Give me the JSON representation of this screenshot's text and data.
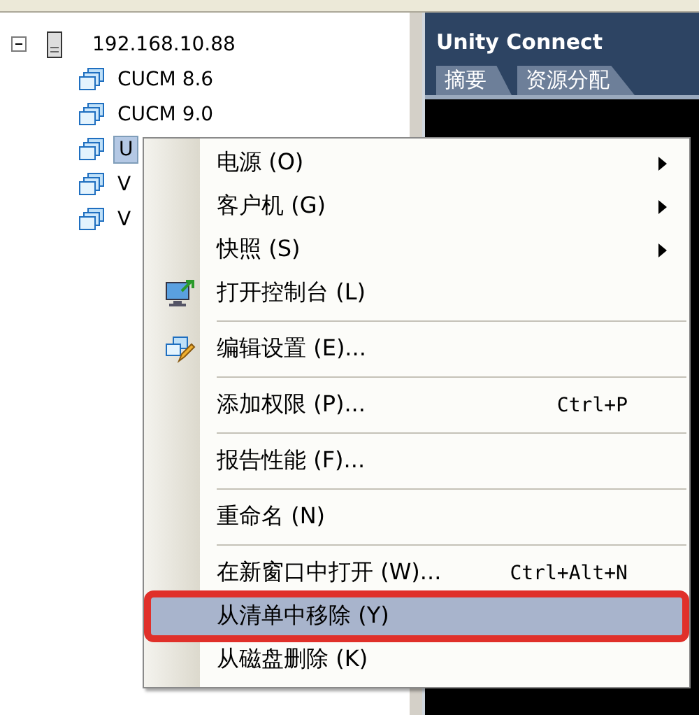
{
  "tree": {
    "root": {
      "label": "192.168.10.88",
      "expanded": true,
      "children": [
        {
          "label": "CUCM 8.6",
          "selected": false
        },
        {
          "label": "CUCM 9.0",
          "selected": false
        },
        {
          "label": "U",
          "selected": true
        },
        {
          "label": "V",
          "selected": false
        },
        {
          "label": "V",
          "selected": false
        }
      ]
    }
  },
  "detail": {
    "title": "Unity Connect",
    "tabs": [
      {
        "label": "摘要",
        "selected": false
      },
      {
        "label": "资源分配",
        "selected": false
      }
    ]
  },
  "context_menu": {
    "items": [
      {
        "kind": "submenu",
        "label": "电源 (O)",
        "selected": false
      },
      {
        "kind": "submenu",
        "label": "客户机 (G)",
        "selected": false
      },
      {
        "kind": "submenu",
        "label": "快照 (S)",
        "selected": false
      },
      {
        "kind": "console",
        "label": "打开控制台 (L)",
        "selected": false
      },
      {
        "kind": "separator"
      },
      {
        "kind": "edit",
        "label": "编辑设置 (E)...",
        "selected": false
      },
      {
        "kind": "separator"
      },
      {
        "kind": "item",
        "label": "添加权限 (P)...",
        "shortcut": "Ctrl+P",
        "selected": false
      },
      {
        "kind": "separator"
      },
      {
        "kind": "item",
        "label": "报告性能 (F)...",
        "selected": false
      },
      {
        "kind": "separator"
      },
      {
        "kind": "item",
        "label": "重命名 (N)",
        "selected": false
      },
      {
        "kind": "separator"
      },
      {
        "kind": "item",
        "label": "在新窗口中打开 (W)...",
        "shortcut": "Ctrl+Alt+N",
        "selected": false
      },
      {
        "kind": "item",
        "label": "从清单中移除 (Y)",
        "selected": true,
        "highlighted": true
      },
      {
        "kind": "item",
        "label": "从磁盘删除 (K)",
        "selected": false
      }
    ]
  }
}
